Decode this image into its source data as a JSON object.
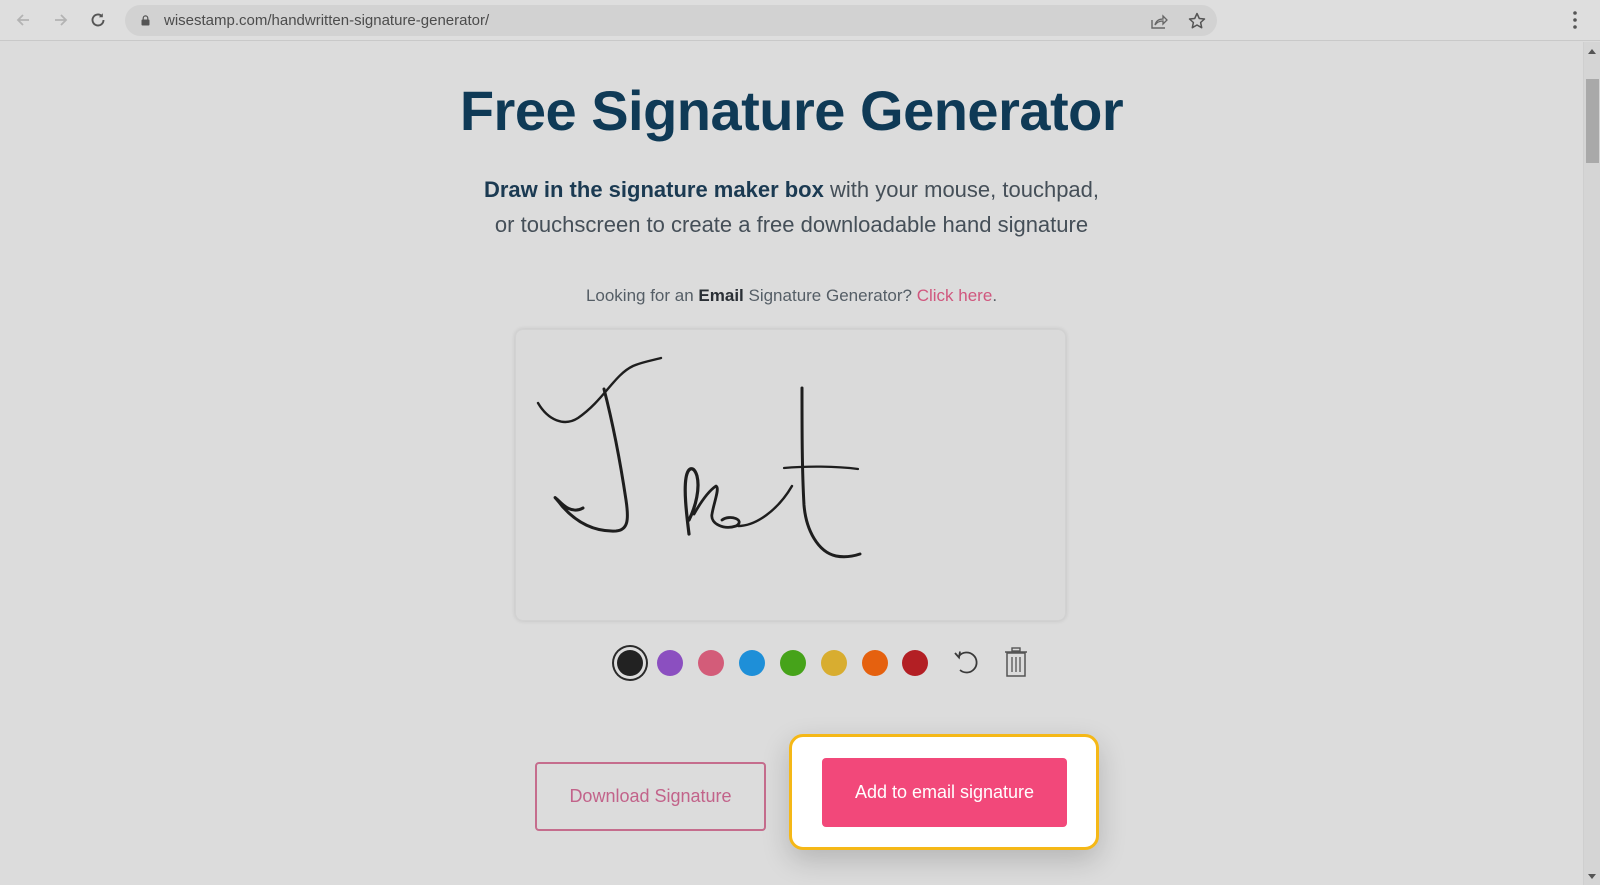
{
  "browser": {
    "url": "wisestamp.com/handwritten-signature-generator/",
    "icons": {
      "back": "arrow-left-icon",
      "forward": "arrow-right-icon",
      "reload": "reload-icon",
      "lock": "lock-icon",
      "share": "share-icon",
      "bookmark": "star-icon",
      "menu": "kebab-menu-icon"
    }
  },
  "page": {
    "title": "Free Signature Generator",
    "subtitle_bold": "Draw in the signature maker box",
    "subtitle_rest_line1": " with your mouse, touchpad,",
    "subtitle_line2": "or touchscreen to create a free downloadable hand signature",
    "lookup_prefix": "Looking for an ",
    "lookup_bold": "Email",
    "lookup_mid": " Signature Generator? ",
    "lookup_link": "Click here",
    "lookup_suffix": "."
  },
  "signature": {
    "drawn_text": "Jest",
    "stroke_color": "#1e1e1e"
  },
  "palette": {
    "selected": "black",
    "colors": [
      {
        "name": "black",
        "hex": "#222222"
      },
      {
        "name": "purple",
        "hex": "#8b4fc0"
      },
      {
        "name": "pink",
        "hex": "#d35c79"
      },
      {
        "name": "blue",
        "hex": "#1e8fd8"
      },
      {
        "name": "green",
        "hex": "#46a31a"
      },
      {
        "name": "yellow",
        "hex": "#d8ad30"
      },
      {
        "name": "orange",
        "hex": "#e5610f"
      },
      {
        "name": "red",
        "hex": "#b31f24"
      }
    ],
    "undo_icon": "undo-icon",
    "clear_icon": "trash-icon"
  },
  "actions": {
    "download_label": "Download Signature",
    "add_label": "Add to email signature",
    "accent_color": "#f2487a",
    "highlight_color": "#f5b817"
  }
}
